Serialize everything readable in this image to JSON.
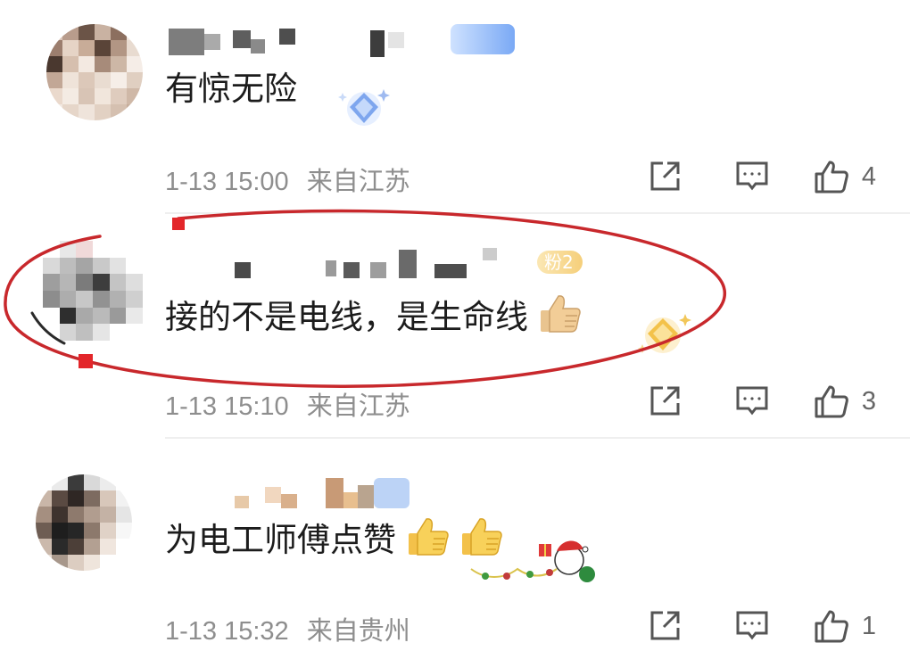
{
  "comments": [
    {
      "text": "有惊无险",
      "time": "1-13 15:00",
      "location": "来自江苏",
      "likes": "4"
    },
    {
      "text": "接的不是电线，是生命线",
      "time": "1-13 15:10",
      "location": "来自江苏",
      "likes": "3",
      "fan_badge": "粉2"
    },
    {
      "text": "为电工师傅点赞",
      "time": "1-13 15:32",
      "location": "来自贵州",
      "likes": "1"
    }
  ],
  "icons": {
    "share": "share-icon",
    "reply": "comment-icon",
    "like": "thumbs-up-icon",
    "emoji": "thumbs-up-emoji",
    "medal": "diamond-medal-icon"
  },
  "colors": {
    "meta_text": "#8e8e8e",
    "annotation": "#c8282c",
    "icon": "#555555"
  }
}
